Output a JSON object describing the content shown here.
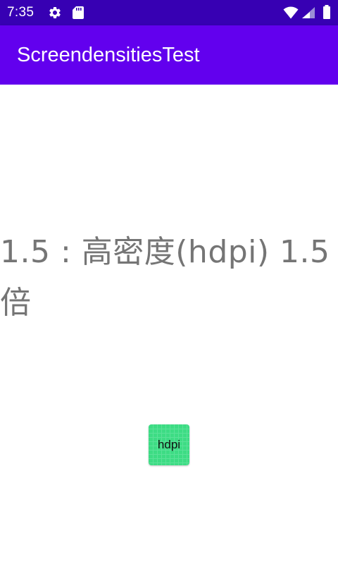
{
  "status_bar": {
    "time": "7:35",
    "icons": [
      "gear-icon",
      "sd-card-icon",
      "wifi-icon",
      "cell-signal-icon",
      "battery-icon"
    ]
  },
  "app_bar": {
    "title": "ScreendensitiesTest"
  },
  "main": {
    "density_text": "1.5 : 高密度(hdpi) 1.5倍",
    "image_label": "hdpi"
  },
  "colors": {
    "status_bar": "#3700b3",
    "app_bar": "#6200ee",
    "text_gray": "#757575",
    "tile_green": "#3ddc84"
  }
}
